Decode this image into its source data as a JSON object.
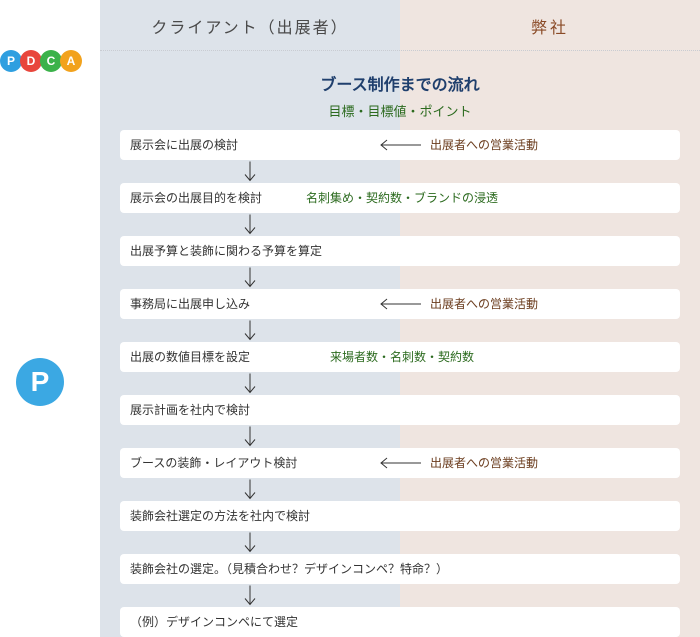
{
  "headers": {
    "client": "クライアント（出展者）",
    "us": "弊社"
  },
  "pdca": {
    "letters": [
      {
        "text": "P",
        "color": "#2f9fe0"
      },
      {
        "text": "D",
        "color": "#e8463c"
      },
      {
        "text": "C",
        "color": "#3bb24a"
      },
      {
        "text": "A",
        "color": "#f2a21d"
      }
    ]
  },
  "phase": {
    "letter": "P",
    "color": "#3ba8e3"
  },
  "title": "ブース制作までの流れ",
  "subtitle": "目標・目標値・ポイント",
  "steps": [
    {
      "label": "展示会に出展の検討",
      "note": "出展者への営業活動",
      "note_kind": "activity"
    },
    {
      "label": "展示会の出展目的を検討",
      "note": "名刺集め・契約数・ブランドの浸透",
      "note_kind": "goal"
    },
    {
      "label": "出展予算と装飾に関わる予算を算定",
      "note": "",
      "note_kind": "none"
    },
    {
      "label": "事務局に出展申し込み",
      "note": "出展者への営業活動",
      "note_kind": "activity"
    },
    {
      "label": "出展の数値目標を設定",
      "note": "来場者数・名刺数・契約数",
      "note_kind": "goal"
    },
    {
      "label": "展示計画を社内で検討",
      "note": "",
      "note_kind": "none"
    },
    {
      "label": "ブースの装飾・レイアウト検討",
      "note": "出展者への営業活動",
      "note_kind": "activity"
    },
    {
      "label": "装飾会社選定の方法を社内で検討",
      "note": "",
      "note_kind": "none"
    },
    {
      "label": "装飾会社の選定。（見積合わせ？デザインコンペ？特命？）",
      "note": "",
      "note_kind": "none"
    },
    {
      "label": "（例）デザインコンペにて選定",
      "note": "",
      "note_kind": "none"
    }
  ],
  "colors": {
    "title": "#1f3f6d",
    "goal_text": "#2b6a1e",
    "activity_text": "#6a3b1c",
    "client_column": "#dde3ea",
    "us_column": "#efe5e0"
  }
}
